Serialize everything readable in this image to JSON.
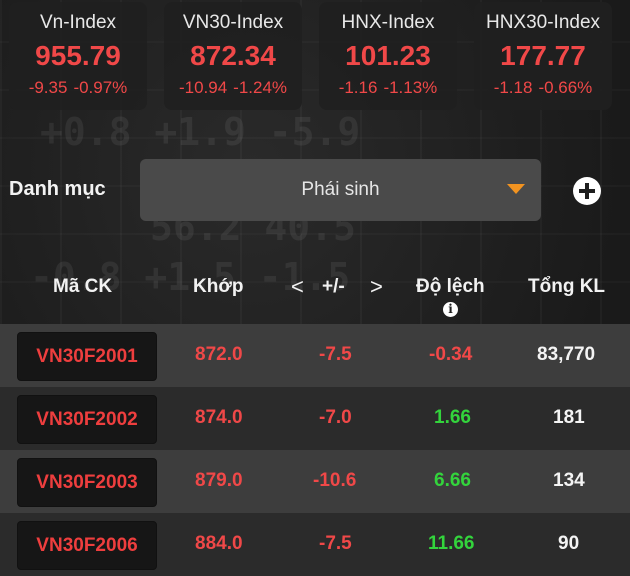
{
  "indices": [
    {
      "name": "Vn-Index",
      "value": "955.79",
      "change": "-9.35",
      "percent": "-0.97%"
    },
    {
      "name": "VN30-Index",
      "value": "872.34",
      "change": "-10.94",
      "percent": "-1.24%"
    },
    {
      "name": "HNX-Index",
      "value": "101.23",
      "change": "-1.16",
      "percent": "-1.13%"
    },
    {
      "name": "HNX30-Index",
      "value": "177.77",
      "change": "-1.18",
      "percent": "-0.66%"
    }
  ],
  "filter": {
    "label": "Danh mục",
    "selected": "Phái sinh",
    "add_icon": "plus-circle-icon",
    "caret_color": "#f29320"
  },
  "table": {
    "headers": {
      "symbol": "Mã CK",
      "match": "Khớp",
      "prev": "<",
      "change": "+/-",
      "next": ">",
      "basis": "Độ lệch",
      "volume": "Tổng KL"
    },
    "rows": [
      {
        "symbol": "VN30F2001",
        "match": "872.0",
        "change": "-7.5",
        "basis": "-0.34",
        "volume": "83,770"
      },
      {
        "symbol": "VN30F2002",
        "match": "874.0",
        "change": "-7.0",
        "basis": "1.66",
        "volume": "181"
      },
      {
        "symbol": "VN30F2003",
        "match": "879.0",
        "change": "-10.6",
        "basis": "6.66",
        "volume": "134"
      },
      {
        "symbol": "VN30F2006",
        "match": "884.0",
        "change": "-7.5",
        "basis": "11.66",
        "volume": "90"
      }
    ]
  },
  "colors": {
    "down": "#f04848",
    "up": "#33d43c"
  }
}
